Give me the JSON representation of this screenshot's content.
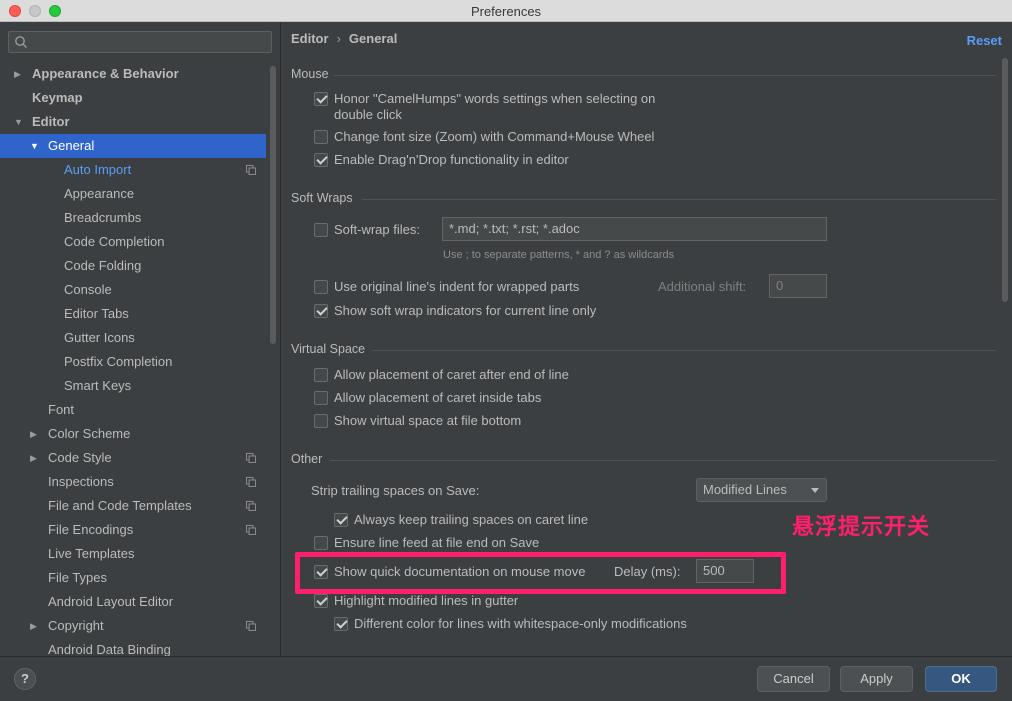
{
  "window": {
    "title": "Preferences"
  },
  "sidebar": {
    "search_placeholder": "",
    "items": [
      {
        "label": "Appearance & Behavior",
        "level": 0,
        "arrow": "right",
        "bold": true
      },
      {
        "label": "Keymap",
        "level": 0,
        "bold": true
      },
      {
        "label": "Editor",
        "level": 0,
        "arrow": "down",
        "bold": true
      },
      {
        "label": "General",
        "level": 1,
        "arrow": "down",
        "selected": true
      },
      {
        "label": "Auto Import",
        "level": 2,
        "link": true,
        "copy": true
      },
      {
        "label": "Appearance",
        "level": 2
      },
      {
        "label": "Breadcrumbs",
        "level": 2
      },
      {
        "label": "Code Completion",
        "level": 2
      },
      {
        "label": "Code Folding",
        "level": 2
      },
      {
        "label": "Console",
        "level": 2
      },
      {
        "label": "Editor Tabs",
        "level": 2
      },
      {
        "label": "Gutter Icons",
        "level": 2
      },
      {
        "label": "Postfix Completion",
        "level": 2
      },
      {
        "label": "Smart Keys",
        "level": 2
      },
      {
        "label": "Font",
        "level": 1
      },
      {
        "label": "Color Scheme",
        "level": 1,
        "arrow": "right"
      },
      {
        "label": "Code Style",
        "level": 1,
        "arrow": "right",
        "copy": true
      },
      {
        "label": "Inspections",
        "level": 1,
        "copy": true
      },
      {
        "label": "File and Code Templates",
        "level": 1,
        "copy": true
      },
      {
        "label": "File Encodings",
        "level": 1,
        "copy": true
      },
      {
        "label": "Live Templates",
        "level": 1
      },
      {
        "label": "File Types",
        "level": 1
      },
      {
        "label": "Android Layout Editor",
        "level": 1
      },
      {
        "label": "Copyright",
        "level": 1,
        "arrow": "right",
        "copy": true
      },
      {
        "label": "Android Data Binding",
        "level": 1
      }
    ]
  },
  "content": {
    "breadcrumb": {
      "parent": "Editor",
      "separator": "›",
      "current": "General"
    },
    "reset_label": "Reset",
    "mouse": {
      "title": "Mouse",
      "camel_humps_1": "Honor \"CamelHumps\" words settings when selecting on",
      "camel_humps_2": "double click",
      "change_font_size": "Change font size (Zoom) with Command+Mouse Wheel",
      "drag_drop": "Enable Drag'n'Drop functionality in editor"
    },
    "soft_wraps": {
      "title": "Soft Wraps",
      "soft_wrap_files": "Soft-wrap files:",
      "soft_wrap_value": "*.md; *.txt; *.rst; *.adoc",
      "hint": "Use ; to separate patterns, * and ? as wildcards",
      "original_indent": "Use original line's indent for wrapped parts",
      "additional_shift_label": "Additional shift:",
      "additional_shift_value": "0",
      "show_indicators": "Show soft wrap indicators for current line only"
    },
    "virtual_space": {
      "title": "Virtual Space",
      "after_end": "Allow placement of caret after end of line",
      "inside_tabs": "Allow placement of caret inside tabs",
      "file_bottom": "Show virtual space at file bottom"
    },
    "other": {
      "title": "Other",
      "strip_label": "Strip trailing spaces on Save:",
      "strip_value": "Modified Lines",
      "keep_trailing": "Always keep trailing spaces on caret line",
      "line_feed": "Ensure line feed at file end on Save",
      "quick_doc": "Show quick documentation on mouse move",
      "delay_label": "Delay (ms):",
      "delay_value": "500",
      "highlight_modified": "Highlight modified lines in gutter",
      "different_color": "Different color for lines with whitespace-only modifications"
    },
    "annotation": "悬浮提示开关"
  },
  "footer": {
    "help": "?",
    "cancel": "Cancel",
    "apply": "Apply",
    "ok": "OK"
  },
  "colors": {
    "background": "#3c3f41",
    "selection": "#2f65ca",
    "link": "#589df6",
    "annotation": "#ff1f6b",
    "primary_button": "#365880"
  }
}
